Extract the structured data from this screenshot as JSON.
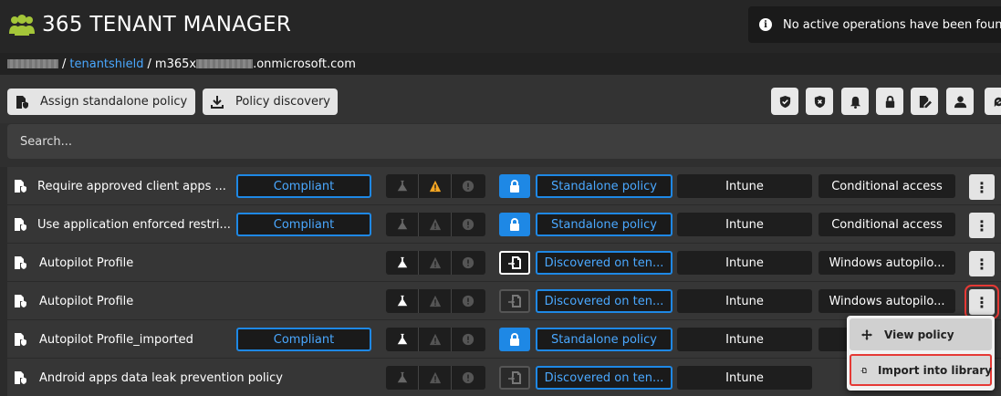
{
  "app": {
    "title": "365 TENANT MANAGER"
  },
  "notification": {
    "text": "No active operations have been found"
  },
  "breadcrumb": {
    "sep1": "/",
    "tenant": "tenantshield",
    "sep2": "/",
    "domain_prefix": "m365x",
    "domain_suffix": ".onmicrosoft.com"
  },
  "toolbar": {
    "assign_label": "Assign standalone policy",
    "discovery_label": "Policy discovery",
    "icons": [
      "shield-check-icon",
      "shield-x-icon",
      "bell-icon",
      "lock-icon",
      "edit-doc-icon",
      "user-icon",
      "refresh-icon"
    ]
  },
  "search": {
    "placeholder": "Search..."
  },
  "colors": {
    "accent": "#1e88e5",
    "link": "#4aa8ff",
    "warning": "#f5a623",
    "highlight": "#e53935"
  },
  "rows": [
    {
      "name": "Require approved client apps ...",
      "compliance": "Compliant",
      "status_warning": true,
      "lock": "locked",
      "type": "Standalone policy",
      "source": "Intune",
      "category": "Conditional access"
    },
    {
      "name": "Use application enforced restri...",
      "compliance": "Compliant",
      "status_warning": false,
      "lock": "locked",
      "type": "Standalone policy",
      "source": "Intune",
      "category": "Conditional access"
    },
    {
      "name": "Autopilot Profile",
      "compliance": "",
      "status_warning": false,
      "lock": "import-active",
      "type": "Discovered on ten...",
      "source": "Intune",
      "category": "Windows autopilo..."
    },
    {
      "name": "Autopilot Profile",
      "compliance": "",
      "status_warning": false,
      "lock": "import-inactive",
      "type": "Discovered on ten...",
      "source": "Intune",
      "category": "Windows autopilo..."
    },
    {
      "name": "Autopilot Profile_imported",
      "compliance": "Compliant",
      "status_warning": false,
      "lock": "locked",
      "type": "Standalone policy",
      "source": "Intune",
      "category": "Win"
    },
    {
      "name": "Android apps data leak prevention policy",
      "compliance": "",
      "status_warning": false,
      "lock": "import-inactive",
      "type": "Discovered on ten...",
      "source": "Intune",
      "category": ""
    }
  ],
  "context_menu": {
    "view_label": "View policy",
    "import_label": "Import into library"
  }
}
